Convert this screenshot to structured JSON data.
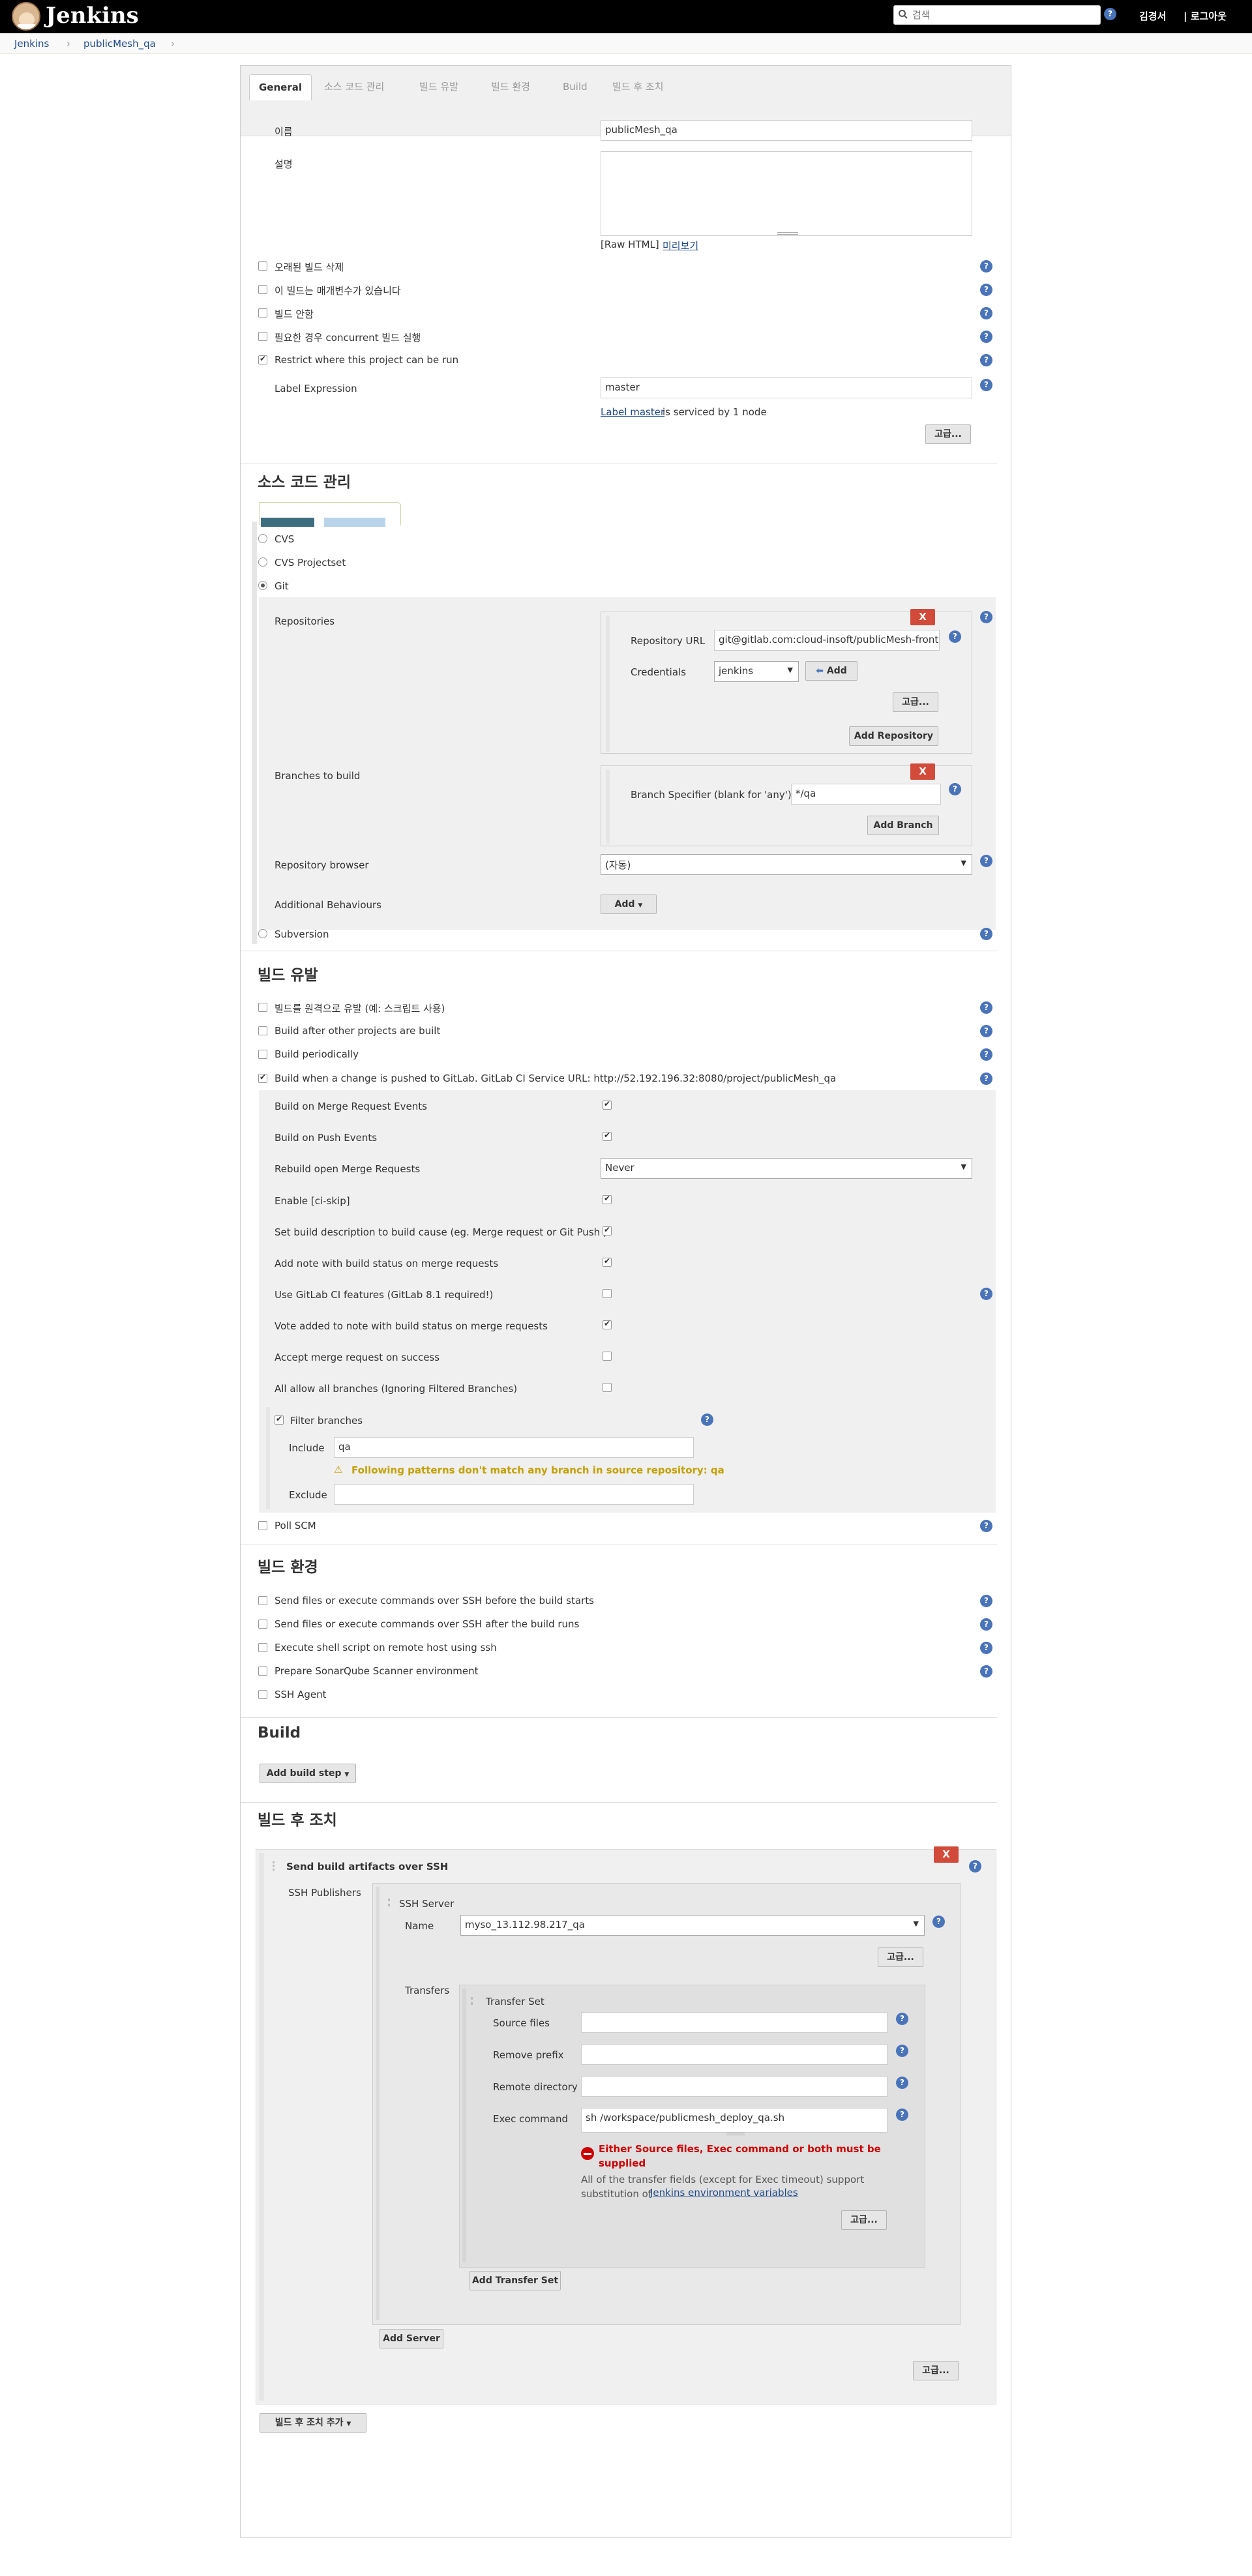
{
  "header": {
    "logo_text": "Jenkins",
    "search_placeholder": "검색",
    "user_name": "김경서",
    "logout_label": "| 로그아웃"
  },
  "breadcrumb": [
    "Jenkins",
    "publicMesh_qa"
  ],
  "tabs": [
    "General",
    "소스 코드 관리",
    "빌드 유발",
    "빌드 환경",
    "Build",
    "빌드 후 조치"
  ],
  "general": {
    "name_label": "이름",
    "name_value": "publicMesh_qa",
    "description_label": "설명",
    "raw_html_label": "[Raw HTML]",
    "preview_label": "미리보기",
    "options": [
      {
        "label": "오래된 빌드 삭제",
        "checked": false
      },
      {
        "label": "이 빌드는 매개변수가 있습니다",
        "checked": false
      },
      {
        "label": "빌드 안함",
        "checked": false
      },
      {
        "label": "필요한 경우 concurrent 빌드 실행",
        "checked": false
      },
      {
        "label": "Restrict where this project can be run",
        "checked": true
      }
    ],
    "label_expression_label": "Label Expression",
    "label_expression_value": "master",
    "label_link": "Label master",
    "label_status": " is serviced by 1 node",
    "advanced_label": "고급..."
  },
  "scm": {
    "title": "소스 코드 관리",
    "options": [
      {
        "label": "CVS",
        "selected": false
      },
      {
        "label": "CVS Projectset",
        "selected": false
      },
      {
        "label": "Git",
        "selected": true
      }
    ],
    "repositories_label": "Repositories",
    "repo_url_label": "Repository URL",
    "repo_url_value": "git@gitlab.com:cloud-insoft/publicMesh-front.g",
    "credentials_label": "Credentials",
    "credentials_value": "jenkins",
    "add_label": "Add",
    "advanced_label": "고급...",
    "add_repository_label": "Add Repository",
    "branches_label": "Branches to build",
    "branch_specifier_label": "Branch Specifier (blank for 'any')",
    "branch_specifier_value": "*/qa",
    "add_branch_label": "Add Branch",
    "repo_browser_label": "Repository browser",
    "repo_browser_value": "(자동)",
    "additional_behaviours_label": "Additional Behaviours",
    "subversion_label": "Subversion",
    "x_label": "X"
  },
  "triggers": {
    "title": "빌드 유발",
    "options": [
      {
        "label": "빌드를 원격으로 유발 (예: 스크립트 사용)",
        "checked": false
      },
      {
        "label": "Build after other projects are built",
        "checked": false
      },
      {
        "label": "Build periodically",
        "checked": false
      },
      {
        "label": "Build when a change is pushed to GitLab. GitLab CI Service URL: http://52.192.196.32:8080/project/publicMesh_qa",
        "checked": true
      }
    ],
    "gitlab_options": [
      {
        "label": "Build on Merge Request Events",
        "checked": true
      },
      {
        "label": "Build on Push Events",
        "checked": true
      },
      {
        "label": "Rebuild open Merge Requests",
        "select": "Never"
      },
      {
        "label": "Enable [ci-skip]",
        "checked": true
      },
      {
        "label": "Set build description to build cause (eg. Merge request or Git Push )",
        "checked": true
      },
      {
        "label": "Add note with build status on merge requests",
        "checked": true
      },
      {
        "label": "Use GitLab CI features (GitLab 8.1 required!)",
        "checked": false
      },
      {
        "label": "Vote added to note with build status on merge requests",
        "checked": true
      },
      {
        "label": "Accept merge request on success",
        "checked": false
      },
      {
        "label": "All allow all branches (Ignoring Filtered Branches)",
        "checked": false
      }
    ],
    "filter_branches_label": "Filter branches",
    "include_label": "Include",
    "include_value": "qa",
    "include_warning": "Following patterns don't match any branch in source repository: qa",
    "exclude_label": "Exclude",
    "poll_scm_label": "Poll SCM"
  },
  "environment": {
    "title": "빌드 환경",
    "options": [
      {
        "label": "Send files or execute commands over SSH before the build starts",
        "checked": false
      },
      {
        "label": "Send files or execute commands over SSH after the build runs",
        "checked": false
      },
      {
        "label": "Execute shell script on remote host using ssh",
        "checked": false
      },
      {
        "label": "Prepare SonarQube Scanner environment",
        "checked": false
      },
      {
        "label": "SSH Agent",
        "checked": false
      }
    ]
  },
  "build": {
    "title": "Build",
    "add_step_label": "Add build step"
  },
  "post_build": {
    "title": "빌드 후 조치",
    "step_title": "Send build artifacts over SSH",
    "ssh_publishers_label": "SSH Publishers",
    "ssh_server_label": "SSH Server",
    "name_label": "Name",
    "name_value": "myso_13.112.98.217_qa",
    "advanced_label": "고급...",
    "transfers_label": "Transfers",
    "transfer_set_label": "Transfer Set",
    "source_files_label": "Source files",
    "remove_prefix_label": "Remove prefix",
    "remote_directory_label": "Remote directory",
    "exec_command_label": "Exec command",
    "exec_command_value": "sh /workspace/publicmesh_deploy_qa.sh",
    "error_message": "Either Source files, Exec command or both must be supplied",
    "info_text": "All of the transfer fields (except for Exec timeout) support substitution of",
    "info_link": "Jenkins environment variables",
    "add_transfer_set_label": "Add Transfer Set",
    "add_server_label": "Add Server",
    "add_post_build_label": "빌드 후 조치 추가",
    "x_label": "X"
  },
  "colors": {
    "header_bg": "#000000",
    "help_icon": "#4a74b9",
    "delete_button": "#d24a3a",
    "link": "#204a87",
    "warning": "#c4a000",
    "error": "#cc0000"
  }
}
